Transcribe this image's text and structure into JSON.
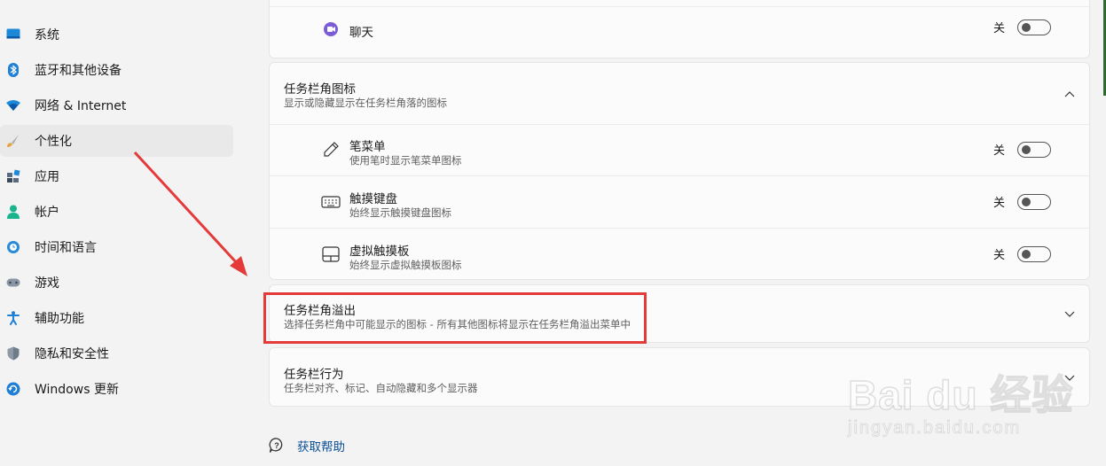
{
  "sidebar": {
    "items": [
      {
        "label": "系统",
        "icon": "monitor-icon"
      },
      {
        "label": "蓝牙和其他设备",
        "icon": "bluetooth-icon"
      },
      {
        "label": "网络 & Internet",
        "icon": "wifi-icon"
      },
      {
        "label": "个性化",
        "icon": "brush-icon",
        "selected": true
      },
      {
        "label": "应用",
        "icon": "apps-icon"
      },
      {
        "label": "帐户",
        "icon": "person-icon"
      },
      {
        "label": "时间和语言",
        "icon": "globe-clock-icon"
      },
      {
        "label": "游戏",
        "icon": "gamepad-icon"
      },
      {
        "label": "辅助功能",
        "icon": "accessibility-icon"
      },
      {
        "label": "隐私和安全性",
        "icon": "shield-icon"
      },
      {
        "label": "Windows 更新",
        "icon": "update-icon"
      }
    ]
  },
  "main": {
    "chat_row": {
      "title": "聊天",
      "state": "关",
      "icon": "chat-icon"
    },
    "corner_icons": {
      "title": "任务栏角图标",
      "subtitle": "显示或隐藏显示在任务栏角落的图标",
      "items": [
        {
          "title": "笔菜单",
          "subtitle": "使用笔时显示笔菜单图标",
          "state": "关",
          "icon": "pen-icon"
        },
        {
          "title": "触摸键盘",
          "subtitle": "始终显示触摸键盘图标",
          "state": "关",
          "icon": "keyboard-icon"
        },
        {
          "title": "虚拟触摸板",
          "subtitle": "始终显示虚拟触摸板图标",
          "state": "关",
          "icon": "touchpad-icon"
        }
      ]
    },
    "overflow": {
      "title": "任务栏角溢出",
      "subtitle": "选择任务栏角中可能显示的图标 - 所有其他图标将显示在任务栏角溢出菜单中"
    },
    "behavior": {
      "title": "任务栏行为",
      "subtitle": "任务栏对齐、标记、自动隐藏和多个显示器"
    },
    "help": {
      "label": "获取帮助",
      "icon": "help-icon"
    }
  },
  "watermark": {
    "brand": "Bai du 经验",
    "url": "jingyan.baidu.com"
  },
  "colors": {
    "highlight": "#e53a3a",
    "link": "#0a4f96",
    "background": "#f3f3f3",
    "card": "#fbfbfb"
  }
}
